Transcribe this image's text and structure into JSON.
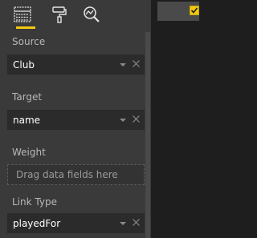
{
  "toolbar": {
    "tabs": [
      {
        "name": "fields",
        "icon": "fields-grid-icon",
        "active": true
      },
      {
        "name": "format",
        "icon": "paint-roller-icon",
        "active": false
      },
      {
        "name": "analytics",
        "icon": "analytics-magnifier-icon",
        "active": false
      }
    ],
    "active_indicator_color": "#f2c811"
  },
  "wells": {
    "source": {
      "label": "Source",
      "value": "Club"
    },
    "target": {
      "label": "Target",
      "value": "name"
    },
    "weight": {
      "label": "Weight",
      "placeholder": "Drag data fields here"
    },
    "link_type": {
      "label": "Link Type",
      "value": "playedFor"
    }
  },
  "right_panel": {
    "checkbox_checked": true,
    "checkbox_color": "#f2c811"
  }
}
